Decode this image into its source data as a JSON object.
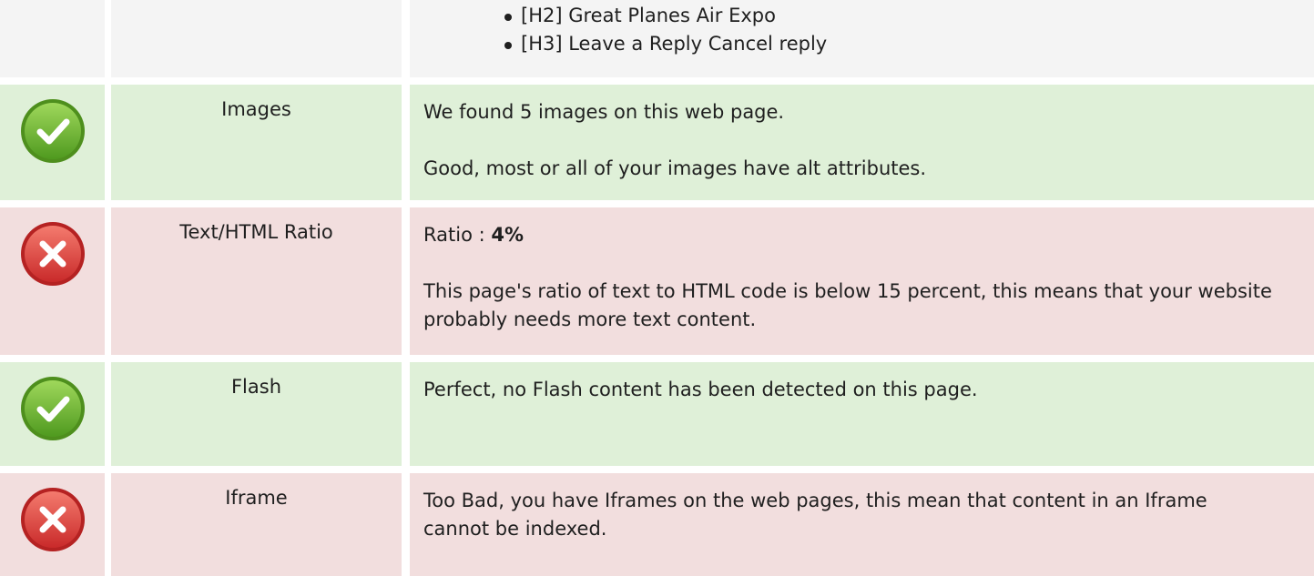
{
  "headings_row": {
    "items": [
      "[H2] Great Planes Air Expo",
      "[H3] Leave a Reply Cancel reply"
    ]
  },
  "rows": [
    {
      "status": "pass",
      "status_color": "#66b32e",
      "label": "Images",
      "lines": [
        "We found 5 images on this web page.",
        "Good, most or all of your images have alt attributes."
      ]
    },
    {
      "status": "fail",
      "status_color": "#dd3b3b",
      "label": "Text/HTML Ratio",
      "ratio_prefix": "Ratio : ",
      "ratio_value": "4%",
      "lines": [
        "This page's ratio of text to HTML code is below 15 percent, this means that your website probably needs more text content."
      ]
    },
    {
      "status": "pass",
      "status_color": "#66b32e",
      "label": "Flash",
      "lines": [
        "Perfect, no Flash content has been detected on this page."
      ]
    },
    {
      "status": "fail",
      "status_color": "#dd3b3b",
      "label": "Iframe",
      "lines": [
        "Too Bad, you have Iframes on the web pages, this mean that content in an Iframe cannot be indexed."
      ]
    }
  ]
}
